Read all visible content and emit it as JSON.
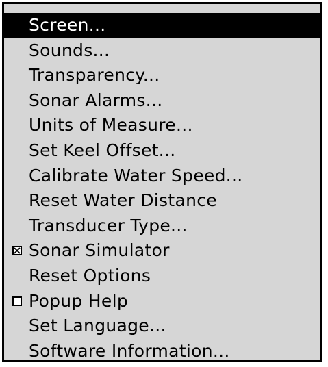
{
  "menu": {
    "items": [
      {
        "label": "Screen...",
        "selected": true,
        "checkbox": null
      },
      {
        "label": "Sounds...",
        "selected": false,
        "checkbox": null
      },
      {
        "label": "Transparency...",
        "selected": false,
        "checkbox": null
      },
      {
        "label": "Sonar Alarms...",
        "selected": false,
        "checkbox": null
      },
      {
        "label": "Units of Measure...",
        "selected": false,
        "checkbox": null
      },
      {
        "label": "Set Keel Offset...",
        "selected": false,
        "checkbox": null
      },
      {
        "label": "Calibrate Water Speed...",
        "selected": false,
        "checkbox": null
      },
      {
        "label": "Reset Water Distance",
        "selected": false,
        "checkbox": null
      },
      {
        "label": "Transducer Type...",
        "selected": false,
        "checkbox": null
      },
      {
        "label": "Sonar Simulator",
        "selected": false,
        "checkbox": "checked"
      },
      {
        "label": "Reset Options",
        "selected": false,
        "checkbox": null
      },
      {
        "label": "Popup Help",
        "selected": false,
        "checkbox": "unchecked"
      },
      {
        "label": "Set Language...",
        "selected": false,
        "checkbox": null
      },
      {
        "label": "Software Information...",
        "selected": false,
        "checkbox": null
      }
    ]
  },
  "colors": {
    "menu_background": "#d6d6d6",
    "selected_background": "#000000",
    "selected_text": "#ffffff",
    "text": "#000000"
  }
}
